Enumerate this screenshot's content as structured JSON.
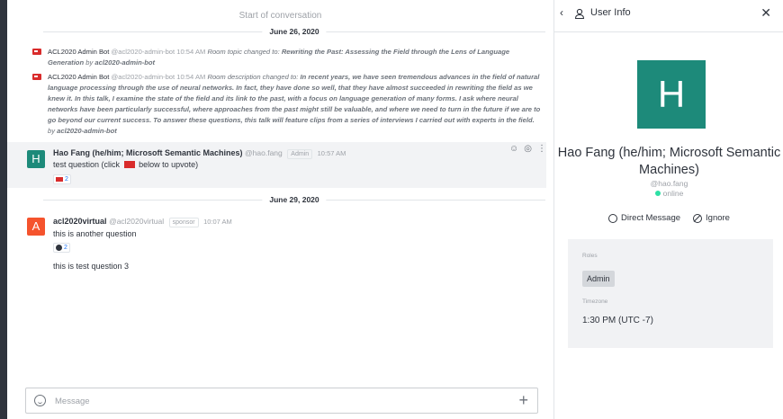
{
  "chat": {
    "start_label": "Start of conversation",
    "dates": [
      "June 26, 2020",
      "June 29, 2020"
    ],
    "system_messages": [
      {
        "author": "ACL2020 Admin Bot",
        "handle": "@acl2020-admin-bot",
        "time": "10:54 AM",
        "action": "Room topic changed to:",
        "value": "Rewriting the Past: Assessing the Field through the Lens of Language Generation",
        "by_label": "by",
        "by": "acl2020-admin-bot"
      },
      {
        "author": "ACL2020 Admin Bot",
        "handle": "@acl2020-admin-bot",
        "time": "10:54 AM",
        "action": "Room description changed to:",
        "value": "In recent years, we have seen tremendous advances in the field of natural language processing through the use of neural networks. In fact, they have done so well, that they have almost succeeded in rewriting the field as we knew it. In this talk, I examine the state of the field and its link to the past, with a focus on language generation of many forms. I ask where neural networks have been particularly successful, where approaches from the past might still be valuable, and where we need to turn in the future if we are to go beyond our current success. To answer these questions, this talk will feature clips from a series of interviews I carried out with experts in the field.",
        "by_label": "by",
        "by": "acl2020-admin-bot"
      }
    ],
    "messages": [
      {
        "avatar_letter": "H",
        "avatar_color": "#1d8a7a",
        "author": "Hao Fang (he/him; Microsoft Semantic Machines)",
        "handle": "@hao.fang",
        "tag": "Admin",
        "time": "10:57 AM",
        "text_before": "test question (click",
        "text_after": "below to upvote)",
        "reaction_count": "2"
      },
      {
        "avatar_letter": "A",
        "avatar_color": "#f5532d",
        "author": "acl2020virtual",
        "handle": "@acl2020virtual",
        "tag": "sponsor",
        "time": "10:07 AM",
        "text": "this is another question",
        "reaction_count": "2",
        "followup": "this is test question 3"
      }
    ],
    "composer": {
      "placeholder": "Message"
    }
  },
  "panel": {
    "title": "User Info",
    "avatar_letter": "H",
    "avatar_color": "#1d8a7a",
    "name": "Hao Fang (he/him; Microsoft Semantic Machines)",
    "handle": "@hao.fang",
    "status": "online",
    "direct_message_label": "Direct Message",
    "ignore_label": "Ignore",
    "roles_label": "Roles",
    "role": "Admin",
    "timezone_label": "Timezone",
    "timezone": "1:30 PM (UTC -7)"
  },
  "icons": [
    "back-icon",
    "user-icon",
    "close-icon",
    "emoji-icon",
    "plus-icon",
    "add-reaction-icon",
    "reply-icon",
    "kebab-menu-icon",
    "flag-icon",
    "chat-bubble-icon",
    "block-icon"
  ]
}
